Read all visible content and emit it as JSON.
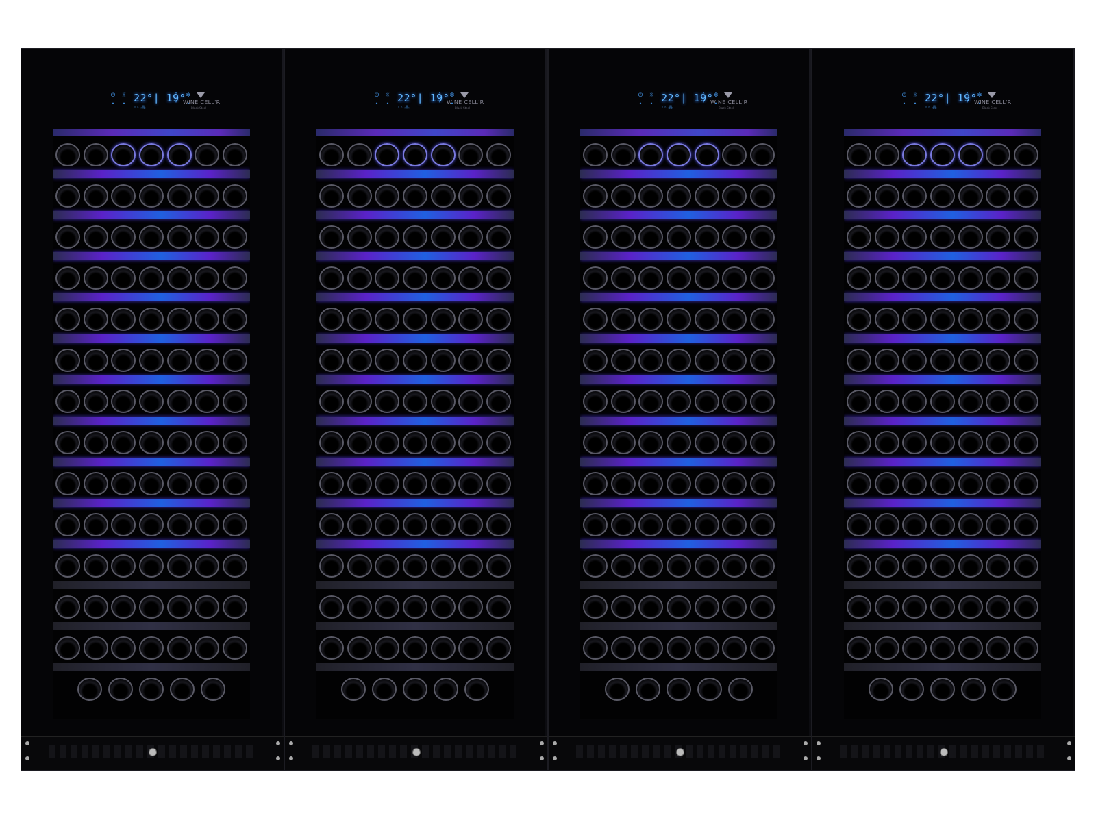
{
  "units": [
    {
      "display": "22°| 19°",
      "brand": "WINE CELL'R",
      "sub_brand": "Black Steel"
    },
    {
      "display": "22°| 19°",
      "brand": "WINE CELL'R",
      "sub_brand": "Black Steel"
    },
    {
      "display": "22°| 19°",
      "brand": "WINE CELL'R",
      "sub_brand": "Black Steel"
    },
    {
      "display": "22°| 19°",
      "brand": "WINE CELL'R",
      "sub_brand": "Black Steel"
    }
  ],
  "icons": {
    "power": "power-icon",
    "light": "light-icon",
    "up": "chevron-up-icon",
    "down": "chevron-down-icon",
    "lock": "lock-icon",
    "logo": "wine-cellr-logo"
  },
  "colors": {
    "cabinet": "#050507",
    "led_purple": "#5a22c8",
    "led_blue": "#2060e0",
    "display_blue": "#62b8ff"
  }
}
